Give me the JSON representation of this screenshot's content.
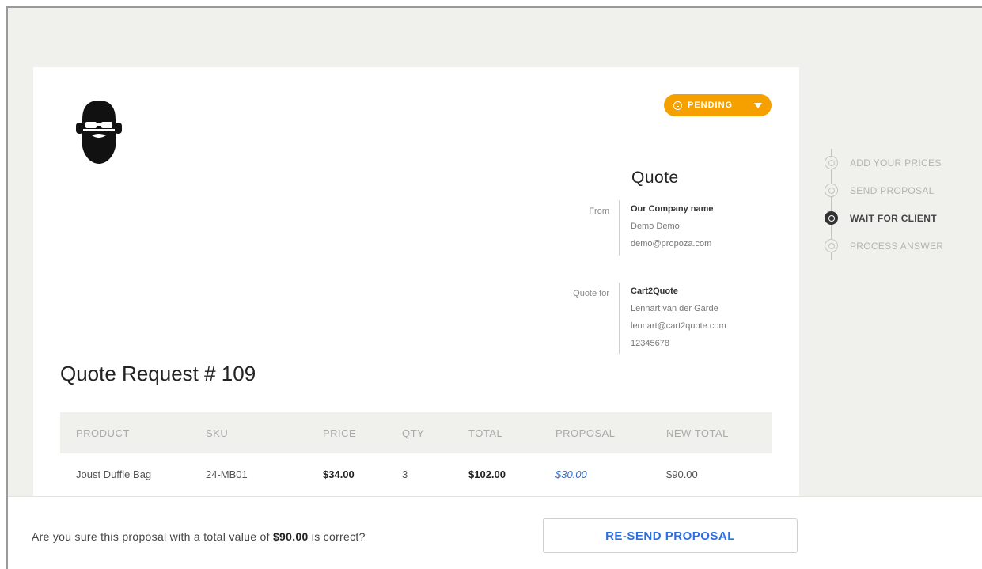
{
  "status": {
    "label": "PENDING",
    "color": "#f6a000"
  },
  "quote": {
    "heading": "Quote",
    "from": {
      "label": "From",
      "company": "Our Company name",
      "contact": "Demo Demo",
      "email": "demo@propoza.com"
    },
    "quote_for": {
      "label": "Quote for",
      "company": "Cart2Quote",
      "contact": "Lennart van der Garde",
      "email": "lennart@cart2quote.com",
      "phone": "12345678"
    }
  },
  "request_title": "Quote Request # 109",
  "table": {
    "headers": {
      "product": "PRODUCT",
      "sku": "SKU",
      "price": "PRICE",
      "qty": "QTY",
      "total": "TOTAL",
      "proposal": "PROPOSAL",
      "new_total": "NEW TOTAL"
    },
    "rows": [
      {
        "product": "Joust Duffle Bag",
        "sku": "24-MB01",
        "price": "$34.00",
        "qty": "3",
        "total": "$102.00",
        "proposal": "$30.00",
        "new_total": "$90.00"
      }
    ]
  },
  "steps": [
    {
      "label": "ADD YOUR PRICES",
      "active": false
    },
    {
      "label": "SEND PROPOSAL",
      "active": false
    },
    {
      "label": "WAIT FOR CLIENT",
      "active": true
    },
    {
      "label": "PROCESS ANSWER",
      "active": false
    }
  ],
  "footer": {
    "confirm_prefix": "Are you sure this proposal with a total value of ",
    "confirm_amount": "$90.00",
    "confirm_suffix": " is correct?",
    "resend_label": "RE-SEND PROPOSAL"
  },
  "icons": {
    "logo": "bearded-man-logo-icon",
    "status": "clock-icon",
    "dropdown": "chevron-down-icon",
    "step": "step-circle-icon"
  },
  "colors": {
    "accent": "#f6a000",
    "link": "#3a6fd1",
    "button_text": "#2c6fe0"
  }
}
